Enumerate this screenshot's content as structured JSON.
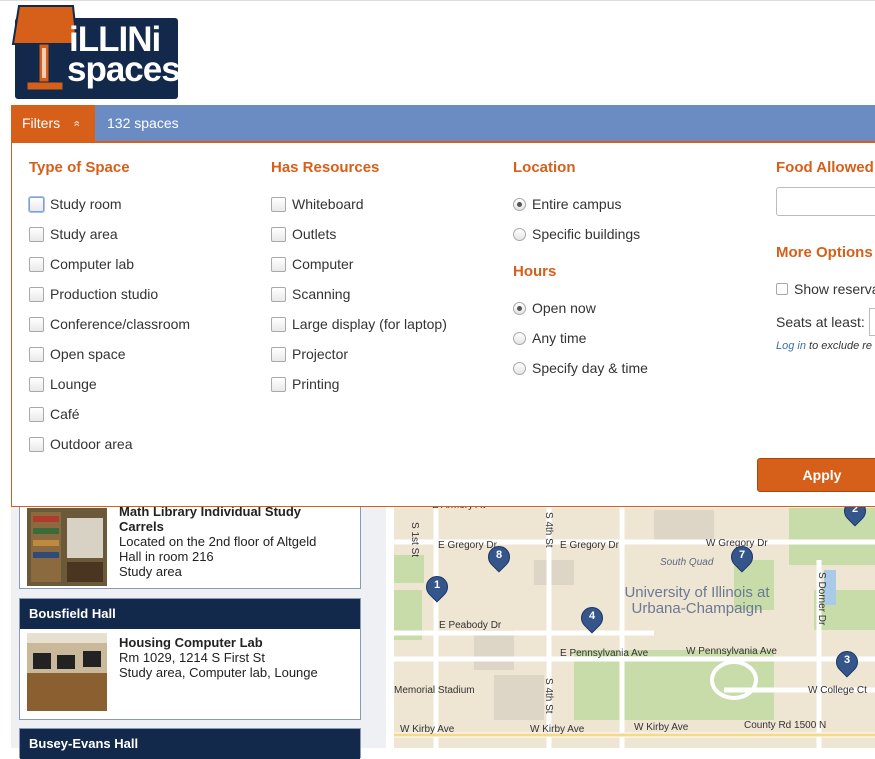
{
  "logo": {
    "line1": "iLLINi",
    "line2": "spaces"
  },
  "toolbar": {
    "filters_label": "Filters",
    "filters_chevron": "«",
    "count": "132 spaces"
  },
  "filters": {
    "type_of_space": {
      "heading": "Type of Space",
      "options": [
        "Study room",
        "Study area",
        "Computer lab",
        "Production studio",
        "Conference/classroom",
        "Open space",
        "Lounge",
        "Café",
        "Outdoor area"
      ]
    },
    "has_resources": {
      "heading": "Has Resources",
      "options": [
        "Whiteboard",
        "Outlets",
        "Computer",
        "Scanning",
        "Large display (for laptop)",
        "Projector",
        "Printing"
      ]
    },
    "location": {
      "heading": "Location",
      "options": [
        "Entire campus",
        "Specific buildings"
      ],
      "selected": "Entire campus"
    },
    "hours": {
      "heading": "Hours",
      "options": [
        "Open now",
        "Any time",
        "Specify day & time"
      ],
      "selected": "Open now"
    },
    "food": {
      "heading": "Food Allowed",
      "value": ""
    },
    "more_options": {
      "heading": "More Options",
      "show_reservable": "Show reserva",
      "seats_label": "Seats at least:",
      "login_link": "Log in",
      "login_note": "to exclude re"
    },
    "apply_label": "Apply"
  },
  "results": [
    {
      "building": "",
      "title": "Math Library Individual Study Carrels",
      "line1": "Located on the 2nd floor of Altgeld",
      "line2": "Hall in room 216",
      "type": "Study area"
    },
    {
      "building": "Bousfield Hall",
      "title": "Housing Computer Lab",
      "line1": "Rm 1029, 1214 S First St",
      "type": "Study area, Computer lab, Lounge"
    },
    {
      "building": "Busey-Evans Hall"
    }
  ],
  "map": {
    "streets": {
      "armory": "E Armory Av",
      "first": "S 1st St",
      "fourth_top": "S 4th St",
      "gregory_w": "E Gregory Dr",
      "gregory_c": "E Gregory Dr",
      "gregory_e": "W Gregory Dr",
      "south_quad": "South Quad",
      "peabody": "E Peabody Dr",
      "penn_e": "E Pennsylvania Ave",
      "penn_w": "W Pennsylvania Ave",
      "dorner": "S Dorner Dr",
      "stadium": "Memorial Stadium",
      "fourth_bottom": "S 4th St",
      "college": "W College Ct",
      "kirby_1": "W Kirby Ave",
      "kirby_2": "W Kirby Ave",
      "kirby_3": "W Kirby Ave",
      "county": "County Rd 1500 N"
    },
    "university": "University of Illinois at Urbana-Champaign",
    "pins": [
      "1",
      "2",
      "3",
      "4",
      "7",
      "8"
    ]
  },
  "colors": {
    "orange": "#d65f1a",
    "navy": "#13294b",
    "bar_blue": "#6b8cc2"
  }
}
